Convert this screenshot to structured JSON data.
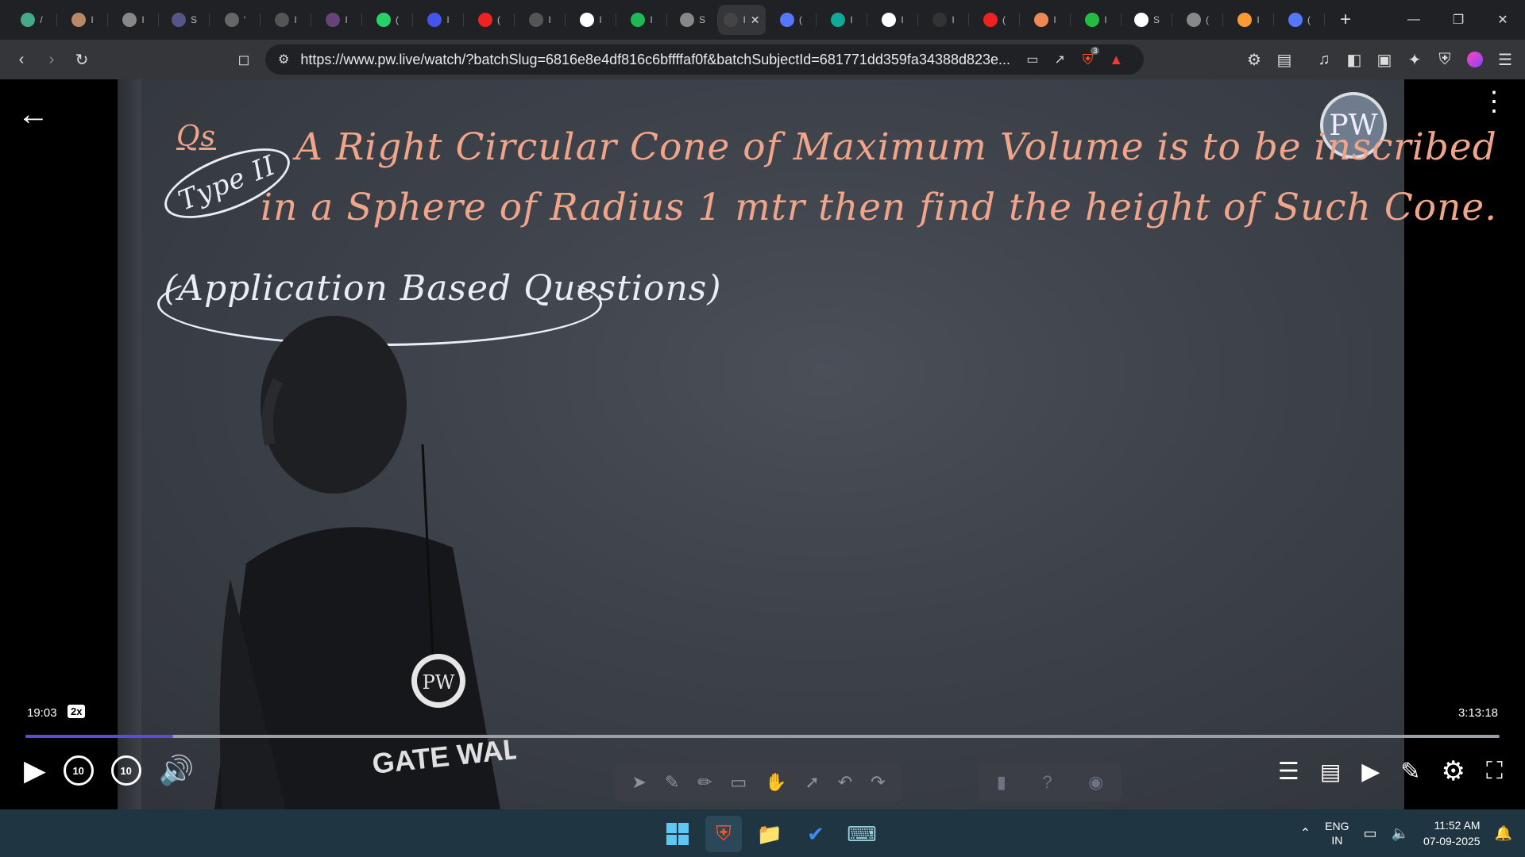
{
  "browser": {
    "tabs": [
      {
        "icon": "browser-icon",
        "title": "/",
        "color": "#4a8"
      },
      {
        "icon": "coin-icon",
        "title": "I",
        "color": "#b86"
      },
      {
        "icon": "globe-icon",
        "title": "I",
        "color": "#888"
      },
      {
        "icon": "chart-icon",
        "title": "S",
        "color": "#558"
      },
      {
        "icon": "w3-icon",
        "title": "'",
        "color": "#666"
      },
      {
        "icon": "circle-icon",
        "title": "I",
        "color": "#555"
      },
      {
        "icon": "purple-icon",
        "title": "I",
        "color": "#647"
      },
      {
        "icon": "whatsapp-icon",
        "title": "(",
        "color": "#25d366"
      },
      {
        "icon": "bookmark-icon",
        "title": "I",
        "color": "#45e"
      },
      {
        "icon": "youtube-icon",
        "title": "(",
        "color": "#e22"
      },
      {
        "icon": "circle-icon",
        "title": "I",
        "color": "#555"
      },
      {
        "icon": "google-icon",
        "title": "I",
        "color": "#fff"
      },
      {
        "icon": "spotify-icon",
        "title": "I",
        "color": "#1db954"
      },
      {
        "icon": "globe-icon",
        "title": "S",
        "color": "#888"
      },
      {
        "icon": "pw-icon",
        "title": "I",
        "color": "#444",
        "active": true
      },
      {
        "icon": "gemini-icon",
        "title": "(",
        "color": "#57f"
      },
      {
        "icon": "chatgpt-icon",
        "title": "I",
        "color": "#1a9"
      },
      {
        "icon": "google-icon",
        "title": "I",
        "color": "#fff"
      },
      {
        "icon": "tv-icon",
        "title": "I",
        "color": "#333"
      },
      {
        "icon": "youtube-icon",
        "title": "(",
        "color": "#e22"
      },
      {
        "icon": "burger-icon",
        "title": "I",
        "color": "#e85"
      },
      {
        "icon": "chart-icon",
        "title": "I",
        "color": "#2b4"
      },
      {
        "icon": "wiki-icon",
        "title": "S",
        "color": "#fff"
      },
      {
        "icon": "globe-icon",
        "title": "(",
        "color": "#888"
      },
      {
        "icon": "flag-icon",
        "title": "I",
        "color": "#f93"
      },
      {
        "icon": "gemini-icon",
        "title": "(",
        "color": "#57f"
      }
    ],
    "url": "https://www.pw.live/watch/?batchSlug=6816e8e4df816c6bffffaf0f&batchSubjectId=681771dd359fa34388d823e...",
    "brave_badge": "3"
  },
  "lecture": {
    "q_label": "Qs",
    "type_label": "Type II",
    "line1": "A Right Circular Cone of Maximum Volume is to be inscribed",
    "line2": "in a Sphere of Radius 1 mtr then find the height of Such Cone.",
    "line3": "(Application Based Questions)",
    "shirt_text": "GATE WALLAH",
    "logo_text": "PW"
  },
  "player": {
    "current_time": "19:03",
    "speed": "2x",
    "duration": "3:13:18",
    "progress": 0.1,
    "skip_back": "10",
    "skip_forward": "10"
  },
  "taskbar": {
    "lang_line1": "ENG",
    "lang_line2": "IN",
    "time": "11:52 AM",
    "date": "07-09-2025"
  }
}
